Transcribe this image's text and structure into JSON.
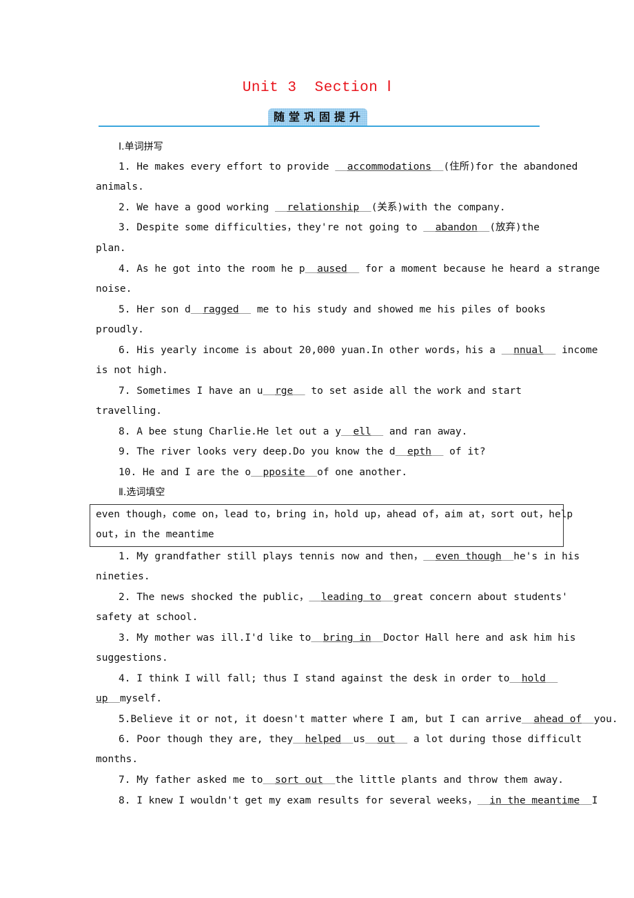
{
  "title": "Unit 3  Section Ⅰ",
  "banner": "随堂巩固提升",
  "section1": {
    "heading": "Ⅰ.单词拼写",
    "items": [
      {
        "pre": "1. He makes every effort to provide ",
        "answer": "accommodations",
        "post": "(住所)for the abandoned",
        "cont": "animals."
      },
      {
        "pre": "2. We have a good working ",
        "answer": "relationship",
        "post": "(关系)with the company.",
        "cont": ""
      },
      {
        "pre": "3. Despite some difficulties，they're not going to ",
        "answer": "abandon",
        "post": "(放弃)the",
        "cont": "plan."
      },
      {
        "pre": "4. As he got into the room he p",
        "answer": "aused",
        "post": " for a moment because he heard a strange",
        "cont": "noise."
      },
      {
        "pre": "5. Her son d",
        "answer": "ragged",
        "post": " me to his study and showed me his piles of books",
        "cont": "proudly."
      },
      {
        "pre": "6. His yearly income is about 20,000 yuan.In other words，his a ",
        "answer": "nnual",
        "post": " income",
        "cont": "is not high."
      },
      {
        "pre": "7. Sometimes I have an u",
        "answer": "rge",
        "post": " to set aside all the work and start",
        "cont": "travelling."
      },
      {
        "pre": "8. A bee stung Charlie.He let out a y",
        "answer": "ell",
        "post": " and ran away.",
        "cont": ""
      },
      {
        "pre": "9. The river looks very deep.Do you know the d",
        "answer": "epth",
        "post": " of it?",
        "cont": ""
      },
      {
        "pre": "10. He and I are the o",
        "answer": "pposite",
        "post": "of one another.",
        "cont": ""
      }
    ]
  },
  "section2": {
    "heading": "Ⅱ.选词填空",
    "word_bank_line1": "even though，come on，lead to，bring in，hold up，ahead of，aim at，sort out，help",
    "word_bank_line2": "out，in the meantime",
    "items": [
      {
        "pre": "1. My grandfather still plays tennis now and then，",
        "answer": "even though",
        "post": "he's in his",
        "cont": "nineties."
      },
      {
        "pre": "2. The news shocked the public，",
        "answer": "leading to",
        "post": "great concern about students'",
        "cont": "safety at school."
      },
      {
        "pre": "3. My mother was ill.I'd like to",
        "answer": "bring in",
        "post": "Doctor Hall here and ask him his",
        "cont": "suggestions."
      },
      {
        "pre": "4. I think I will fall; thus I stand against the desk in order to",
        "answer": "hold",
        "post": "",
        "cont_answer": "up",
        "cont": "myself."
      },
      {
        "pre": "5.Believe it or not, it doesn't matter where I am, but I can arrive",
        "answer": "ahead of",
        "post": "you.",
        "cont": ""
      },
      {
        "pre": "6. Poor though they are, they",
        "answer": "helped",
        "mid": "us",
        "answer2": "out",
        "post": " a lot during those difficult",
        "cont": "months."
      },
      {
        "pre": "7. My father asked me to",
        "answer": "sort out",
        "post": "the little plants and throw them away.",
        "cont": ""
      },
      {
        "pre": "8. I knew I wouldn't get my exam results for several weeks，",
        "answer": "in the meantime",
        "post": "I",
        "cont": ""
      }
    ]
  }
}
